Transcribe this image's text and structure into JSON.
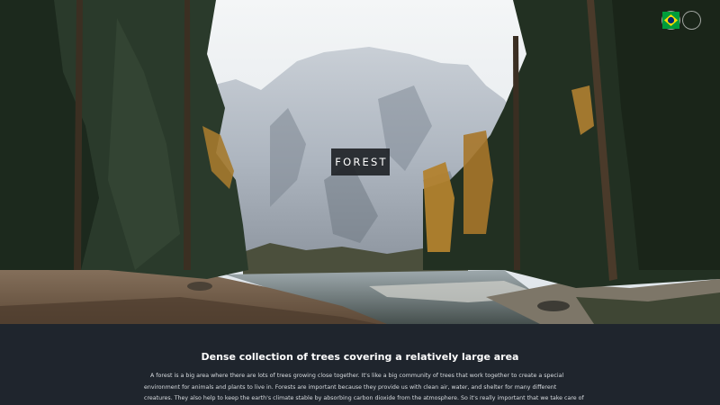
{
  "hero": {
    "title": "FOREST",
    "image_subject": "forest-lake-mountain-photo"
  },
  "language_switcher": {
    "options": [
      {
        "name": "english-flag-icon",
        "lang": "en-US"
      },
      {
        "name": "portuguese-flag-icon",
        "lang": "pt-BR"
      }
    ]
  },
  "section": {
    "heading": "Dense collection of trees covering a relatively large area",
    "body": "A forest is a big area where there are lots of trees growing close together. It's like a big community of trees that work together to create a special environment for animals and plants to live in. Forests are important because they provide us with clean air, water, and shelter for many different creatures. They also help to keep the earth's climate stable by absorbing carbon dioxide from the atmosphere. So it's really important that we take care of"
  },
  "colors": {
    "dark_bg": "#1f252d",
    "badge_bg": "#212529",
    "text_light": "#ffffff"
  }
}
